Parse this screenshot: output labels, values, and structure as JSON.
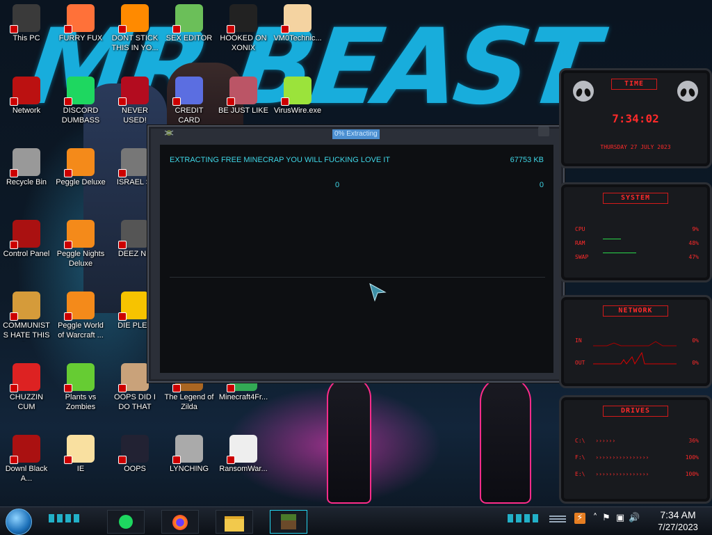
{
  "wallpaper": {
    "graffiti_text": "MR BEAST"
  },
  "desktop_icons": [
    {
      "label": "This PC",
      "icon": "computer-icon"
    },
    {
      "label": "FURRY FUX",
      "icon": "firefox-icon"
    },
    {
      "label": "DONT STICK THIS IN YO...",
      "icon": "vlc-cone-icon"
    },
    {
      "label": "SEX EDITOR",
      "icon": "hex-editor-icon"
    },
    {
      "label": "HOOKED ON XONIX",
      "icon": "xonix-game-icon"
    },
    {
      "label": "VM0Technic...",
      "icon": "doctor-icon"
    },
    {
      "label": "Network",
      "icon": "network-icon"
    },
    {
      "label": "DISCORD DUMBASS",
      "icon": "spotify-icon"
    },
    {
      "label": "NEVER USED!",
      "icon": "dev-cpp-icon"
    },
    {
      "label": "CREDIT CARD",
      "icon": "credit-card-icon"
    },
    {
      "label": "BE JUST LIKE",
      "icon": "santa-icon"
    },
    {
      "label": "VirusWire.exe",
      "icon": "lime-icon"
    },
    {
      "label": "Recycle Bin",
      "icon": "recycle-bin-icon"
    },
    {
      "label": "Peggle Deluxe",
      "icon": "peggle-icon"
    },
    {
      "label": "ISRAEL SI",
      "icon": "window-icon"
    },
    {
      "label": "Control Panel",
      "icon": "control-panel-icon"
    },
    {
      "label": "Peggle Nights Deluxe",
      "icon": "peggle-icon"
    },
    {
      "label": "DEEZ NU",
      "icon": "windows-stack-icon"
    },
    {
      "label": "COMMUNISTS HATE THIS G...",
      "icon": "money-bag-icon"
    },
    {
      "label": "Peggle World of Warcraft ...",
      "icon": "peggle-icon"
    },
    {
      "label": "DIE PLEA",
      "icon": "die-logo-icon"
    },
    {
      "label": "CHUZZIN CUM",
      "icon": "chuzzle-icon"
    },
    {
      "label": "Plants vs Zombies",
      "icon": "flower-icon"
    },
    {
      "label": "OOPS DID I DO THAT",
      "icon": "portrait-icon"
    },
    {
      "label": "The Legend of Zilda",
      "icon": "zelda-icon"
    },
    {
      "label": "Minecraft4Fr...",
      "icon": "minecraft-icon"
    },
    {
      "label": "Downl Black A...",
      "icon": "alien-icon"
    },
    {
      "label": "IE",
      "icon": "star-character-icon"
    },
    {
      "label": "OOPS",
      "icon": "computer-icon"
    },
    {
      "label": "LYNCHING",
      "icon": "noose-icon"
    },
    {
      "label": "RansomWar...",
      "icon": "skull-icon"
    }
  ],
  "dialog": {
    "title": "0% Extracting",
    "message": "EXTRACTING FREE MINECRAP YOU WILL FUCKING LOVE IT",
    "size": "67753 KB",
    "left_count": "0",
    "right_count": "0"
  },
  "gadget_time": {
    "header": "TIME",
    "clock": "7:34:02",
    "date": "THURSDAY 27 JULY 2023"
  },
  "gadget_system": {
    "header": "SYSTEM",
    "rows": [
      {
        "label": "CPU",
        "value": "9%"
      },
      {
        "label": "RAM",
        "value": "48%"
      },
      {
        "label": "SWAP",
        "value": "47%"
      }
    ]
  },
  "gadget_network": {
    "header": "NETWORK",
    "rows": [
      {
        "label": "IN",
        "value": "0%"
      },
      {
        "label": "OUT",
        "value": "0%"
      }
    ]
  },
  "gadget_drives": {
    "header": "DRIVES",
    "rows": [
      {
        "label": "C:\\",
        "value": "36%"
      },
      {
        "label": "F:\\",
        "value": "100%"
      },
      {
        "label": "E:\\",
        "value": "100%"
      }
    ]
  },
  "taskbar": {
    "pinned": [
      "spotify-icon",
      "firefox-icon",
      "file-explorer-icon",
      "minecraft-icon"
    ],
    "clock_time": "7:34 AM",
    "clock_date": "7/27/2023"
  }
}
